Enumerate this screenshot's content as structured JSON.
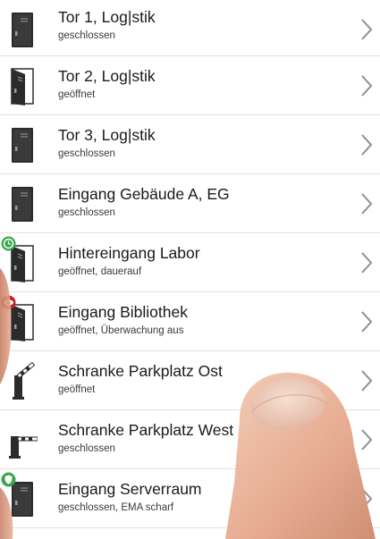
{
  "list": {
    "items": [
      {
        "title": "Tor 1, Log|stik",
        "status": "geschlossen",
        "icon": "door-closed-icon"
      },
      {
        "title": "Tor 2, Log|stik",
        "status": "geöffnet",
        "icon": "door-open-icon"
      },
      {
        "title": "Tor 3, Log|stik",
        "status": "geschlossen",
        "icon": "door-closed-icon"
      },
      {
        "title": "Eingang Gebäude A, EG",
        "status": "geschlossen",
        "icon": "door-closed-icon"
      },
      {
        "title": "Hintereingang Labor",
        "status": "geöffnet, dauerauf",
        "icon": "door-open-icon",
        "badge": "clock-badge-icon"
      },
      {
        "title": "Eingang Bibliothek",
        "status": "geöffnet, Überwachung aus",
        "icon": "door-open-icon",
        "badge": "eye-badge-icon"
      },
      {
        "title": "Schranke Parkplatz Ost",
        "status": "geöffnet",
        "icon": "barrier-open-icon"
      },
      {
        "title": "Schranke Parkplatz West",
        "status": "geschlossen",
        "icon": "barrier-closed-icon"
      },
      {
        "title": "Eingang Serverraum",
        "status": "geschlossen, EMA scharf",
        "icon": "door-closed-icon",
        "badge": "shield-badge-icon"
      }
    ]
  },
  "colors": {
    "clock_badge": "#3aa64a",
    "eye_badge": "#c0202a",
    "shield_badge": "#3aa64a",
    "chevron": "#8e8e93",
    "divider": "#e2e2e2"
  }
}
